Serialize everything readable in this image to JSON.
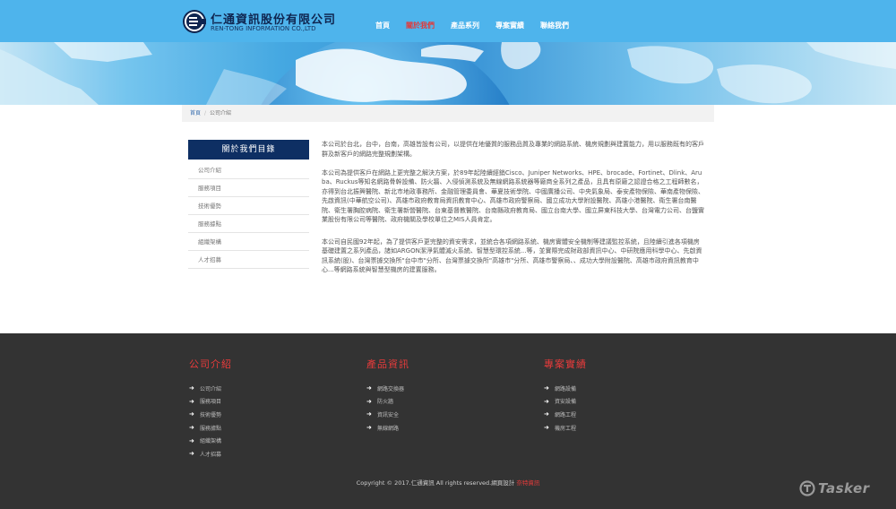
{
  "brand": {
    "title": "仁通資訊股份有限公司",
    "subtitle": "REN-TONG INFORMATION CO.,LTD"
  },
  "nav": {
    "items": [
      {
        "label": "首頁"
      },
      {
        "label": "關於我們"
      },
      {
        "label": "產品系列"
      },
      {
        "label": "專案實績"
      },
      {
        "label": "聯絡我們"
      }
    ],
    "active_index": 1
  },
  "breadcrumb": {
    "home": "首頁",
    "separator": "/",
    "current": "公司介紹"
  },
  "sidebar": {
    "title": "關於我們目錄",
    "items": [
      {
        "label": "公司介紹"
      },
      {
        "label": "服務項目"
      },
      {
        "label": "技術優勢"
      },
      {
        "label": "服務據點"
      },
      {
        "label": "組織架構"
      },
      {
        "label": "人才招募"
      }
    ]
  },
  "main": {
    "paragraphs": [
      "本公司於台北，台中，台南，高雄皆設有公司，以提供在地優質的服務品質及專業的網路系統、機房規劃與建置能力，用以服務既有的客戶群及新客戶的網路完整規劃架構。",
      "本公司為提供客戶在網路上更完整之解決方案，於89年起陸續經銷Cisco、Juniper Networks、HPE、brocade、Fortinet、Dlink、Aruba、Ruckus等知名網路骨幹設備、防火牆、入侵偵測系統及無線網路系統器等廠商全系列之產品，且具有原廠之認證合格之工程師數名，亦得到台北振興醫院、新北市地政事務所、金融管理委員會、華夏技術學院、中國廣播公司、中央氣象局、泰安產物保險、華南產物保險、先啟資訊(中華航空公司)、高雄市政府教育局資訊教育中心、高雄市政府警察局、國立成功大學附設醫院、高雄小港醫院、衛生署台南醫院、衛生署胸腔病院、衛生署新營醫院、台東基督教醫院、台南縣政府教育局、國立台南大學、國立屏東科技大學、台灣電力公司、台鹽實業股份有限公司等醫院、政府機關及學校單位之MIS人員肯定。",
      "本公司自民國92年起，為了提供客戶更完整的資安需求，並統合各項網路系統、機房實體安全機制等建議監控系統，且陸續引進各項機房基礎建置之系列產品，諸如ARGON潔淨氣體滅火系統、智慧型環控系統...等，並實際完成財政部資訊中心、中研院應用科學中心、先啟資訊系統(股)、台灣票據交換所\"台中市\"分所、台灣票據交換所\"高雄市\"分所、高雄市警察局、、成功大學附設醫院、高雄市政府資訊教育中心...等網路系統與智慧型機房的建置服務。"
    ]
  },
  "footer": {
    "columns": [
      {
        "title": "公司介紹",
        "links": [
          {
            "label": "公司介紹"
          },
          {
            "label": "服務項目"
          },
          {
            "label": "技術優勢"
          },
          {
            "label": "服務據點"
          },
          {
            "label": "組織架構"
          },
          {
            "label": "人才招募"
          }
        ]
      },
      {
        "title": "產品資訊",
        "links": [
          {
            "label": "網路交換器"
          },
          {
            "label": "防火牆"
          },
          {
            "label": "資訊安全"
          },
          {
            "label": "無線網路"
          }
        ]
      },
      {
        "title": "專案實績",
        "links": [
          {
            "label": "網路設備"
          },
          {
            "label": "資安設備"
          },
          {
            "label": "網路工程"
          },
          {
            "label": "機房工程"
          }
        ]
      }
    ],
    "copyright_text": "Copyright © 2017.仁通資訊 All rights reserved.網頁設計",
    "designer": "奈特資訊"
  },
  "watermark": {
    "text": "Tasker"
  },
  "colors": {
    "header_bg": "#4eb4ec",
    "nav_active": "#e23a3a",
    "sidebar_title_bg": "#0e2f63",
    "footer_bg": "#333333",
    "footer_heading": "#e83b3b"
  }
}
